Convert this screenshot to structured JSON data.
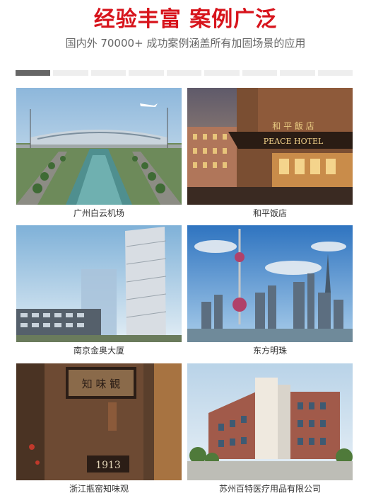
{
  "header": {
    "title": "经验丰富 案例广泛",
    "subtitle": "国内外 70000+ 成功案例涵盖所有加固场景的应用"
  },
  "pager": {
    "segments": 9,
    "active_index": 0
  },
  "cases": [
    {
      "caption": "广州白云机场",
      "image": "airport-photo"
    },
    {
      "caption": "和平饭店",
      "image": "hotel-photo",
      "sign_text": "PEACE HOTEL",
      "sign_chars": "和 平 飯 店"
    },
    {
      "caption": "南京金奥大厦",
      "image": "skyscraper-photo"
    },
    {
      "caption": "东方明珠",
      "image": "skyline-photo"
    },
    {
      "caption": "浙江瓶窑知味观",
      "image": "restaurant-photo",
      "sign_chars": "知 味 観",
      "year_text": "1913"
    },
    {
      "caption": "苏州百特医疗用品有限公司",
      "image": "factory-photo"
    }
  ],
  "colors": {
    "title": "#d7141c",
    "pager_active": "#666666",
    "pager_inactive": "#eeeeee"
  }
}
